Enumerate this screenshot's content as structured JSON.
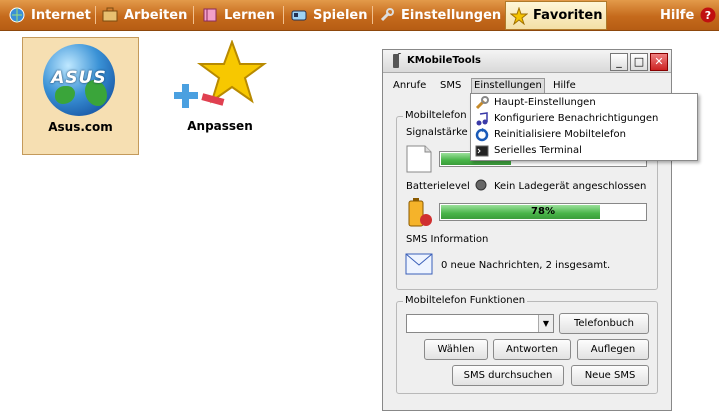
{
  "topbar": {
    "tabs": [
      {
        "label": "Internet",
        "icon": "globe-icon"
      },
      {
        "label": "Arbeiten",
        "icon": "briefcase-icon"
      },
      {
        "label": "Lernen",
        "icon": "book-icon"
      },
      {
        "label": "Spielen",
        "icon": "gamepad-icon"
      },
      {
        "label": "Einstellungen",
        "icon": "wrench-icon"
      },
      {
        "label": "Favoriten",
        "icon": "star-icon",
        "active": true
      }
    ],
    "help_label": "Hilfe"
  },
  "desktop": {
    "asus_logo": "ASUS",
    "asus_label": "Asus.com",
    "customize_label": "Anpassen"
  },
  "window": {
    "title": "KMobileTools",
    "menu": [
      "Anrufe",
      "SMS",
      "Einstellungen",
      "Hilfe"
    ],
    "status_group": {
      "label": "Mobiltelefon I",
      "signal_label": "Signalstärke",
      "battery_label": "Batterielevel",
      "charger_status": "Kein Ladegerät angeschlossen",
      "battery_value": 78,
      "battery_text": "78%",
      "sms_label": "SMS Information",
      "sms_status": "0 neue Nachrichten, 2 insgesamt."
    },
    "functions_group": {
      "label": "Mobiltelefon Funktionen",
      "phonebook_button": "Telefonbuch",
      "dial_button": "Wählen",
      "answer_button": "Antworten",
      "hangup_button": "Auflegen",
      "search_sms_button": "SMS durchsuchen",
      "new_sms_button": "Neue SMS"
    }
  },
  "dropdown": {
    "items": [
      {
        "label": "Haupt-Einstellungen",
        "icon": "wrench-icon"
      },
      {
        "label": "Konfiguriere Benachrichtigungen",
        "icon": "music-note-icon"
      },
      {
        "label": "Reinitialisiere Mobiltelefon",
        "icon": "reload-icon"
      },
      {
        "label": "Serielles Terminal",
        "icon": "terminal-icon"
      }
    ]
  },
  "colors": {
    "accent": "#c56a1c",
    "progress": "#48b448"
  }
}
